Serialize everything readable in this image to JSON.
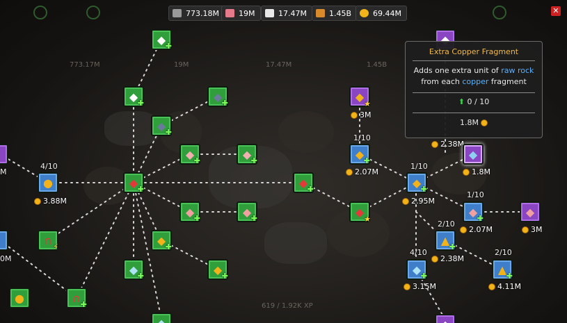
{
  "resources": [
    {
      "icon": "ore-icon",
      "value": "773.18M"
    },
    {
      "icon": "gem-icon",
      "value": "19M"
    },
    {
      "icon": "ingot-icon",
      "value": "17.47M"
    },
    {
      "icon": "crate-icon",
      "value": "1.45B"
    },
    {
      "icon": "coin-icon",
      "value": "69.44M"
    }
  ],
  "background_readouts": {
    "r1": "773.17M",
    "r2": "19M",
    "r3": "17.47M",
    "r4": "1.45B",
    "xp": "619 / 1.92K XP"
  },
  "tooltip": {
    "title": "Extra Copper Fragment",
    "desc_1": "Adds one extra unit of ",
    "desc_hl1": "raw rock",
    "desc_2": " from each ",
    "desc_hl2": "copper",
    "desc_3": " fragment",
    "progress": "0 / 10",
    "price": "1.8M"
  },
  "nodes": {
    "n_top": {
      "icon": "silver-ore-icon"
    },
    "n_l2a": {
      "icon": "silver-ore-icon"
    },
    "n_l2b": {
      "icon": "dark-ore-icon"
    },
    "n_l3a": {
      "icon": "dark-ore-icon"
    },
    "n_mid1": {
      "icon": "pink-ore-icon"
    },
    "n_mid2": {
      "icon": "pink-ore-icon"
    },
    "n_hub": {
      "icon": "red-ore-icon"
    },
    "n_red2": {
      "icon": "red-ore-icon"
    },
    "n_red3": {
      "icon": "red-ore-icon"
    },
    "n_pink3": {
      "icon": "pink-ore-icon"
    },
    "n_pink4": {
      "icon": "pink-ore-icon"
    },
    "n_gold1": {
      "icon": "gold-ore-icon"
    },
    "n_gold2": {
      "icon": "gold-ore-icon"
    },
    "n_diamond1": {
      "icon": "diamond-ore-icon"
    },
    "n_diamond2": {
      "icon": "diamond-ore-icon"
    },
    "n_magnet1": {
      "icon": "magnet-icon"
    },
    "n_magnet2": {
      "icon": "magnet-icon"
    },
    "n_coins1": {
      "icon": "coin-pile-icon"
    },
    "n_coins2": {
      "icon": "coin-pile-icon"
    },
    "n_purple_top": {
      "icon": "silver-ore-icon"
    },
    "n_purple_gold": {
      "icon": "gold-ore-icon",
      "cost": "3M"
    },
    "n_blue_gold": {
      "icon": "gold-ore-icon",
      "level": "1/10",
      "cost": "2.07M"
    },
    "n_blue_gold2": {
      "icon": "gold-ore-icon",
      "level": "1/10",
      "cost": "2.95M"
    },
    "n_purple_copper": {
      "icon": "copper-ore-icon",
      "cost": "1.8M"
    },
    "n_blue_pink": {
      "icon": "pink-ore-icon",
      "level": "1/10",
      "cost": "2.07M"
    },
    "n_purple_pink": {
      "icon": "pink-ore-icon",
      "cost": "3M"
    },
    "n_blue_bag": {
      "icon": "gold-bag-icon",
      "level": "2/10",
      "cost": "2.38M"
    },
    "n_blue_bag2": {
      "icon": "gold-bag-icon",
      "level": "2/10",
      "cost": "4.11M"
    },
    "n_blue_diamond": {
      "icon": "diamond-ore-icon",
      "level": "4/10",
      "cost": "3.15M"
    },
    "n_blue_coins": {
      "icon": "coin-pile-icon",
      "level": "4/10",
      "cost": "3.88M"
    },
    "n_purple_bottom": {
      "icon": "silver-ore-icon"
    }
  },
  "extra_costs": {
    "c_238_top": "2.38M"
  },
  "edge_labels": {
    "left_mid": "M",
    "left_bottom": "0M"
  }
}
